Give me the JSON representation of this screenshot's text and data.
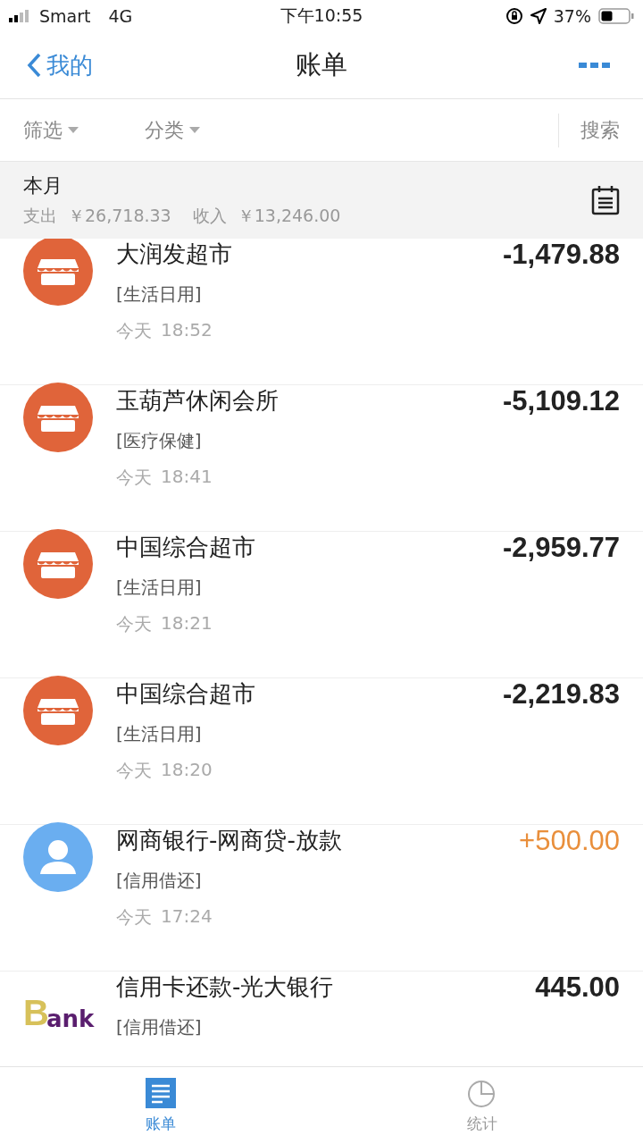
{
  "status_bar": {
    "carrier": "Smart",
    "network": "4G",
    "time": "下午10:55",
    "battery": "37%"
  },
  "nav": {
    "back": "我的",
    "title": "账单"
  },
  "filters": [
    {
      "label": "筛选"
    },
    {
      "label": "分类"
    }
  ],
  "search": "搜索",
  "summary": {
    "period": "本月",
    "expense_label": "支出",
    "expense": "￥26,718.33",
    "income_label": "收入",
    "income": "￥13,246.00"
  },
  "transactions": [
    {
      "kind": "store",
      "name": "大润发超市",
      "category": "[生活日用]",
      "day": "今天",
      "time": "18:52",
      "amount": "-1,479.88",
      "income": false
    },
    {
      "kind": "store",
      "name": "玉葫芦休闲会所",
      "category": "[医疗保健]",
      "day": "今天",
      "time": "18:41",
      "amount": "-5,109.12",
      "income": false
    },
    {
      "kind": "store",
      "name": "中国综合超市",
      "category": "[生活日用]",
      "day": "今天",
      "time": "18:21",
      "amount": "-2,959.77",
      "income": false
    },
    {
      "kind": "store",
      "name": "中国综合超市",
      "category": "[生活日用]",
      "day": "今天",
      "time": "18:20",
      "amount": "-2,219.83",
      "income": false
    },
    {
      "kind": "person",
      "name": "网商银行-网商贷-放款",
      "category": "[信用借还]",
      "day": "今天",
      "time": "17:24",
      "amount": "+500.00",
      "income": true
    },
    {
      "kind": "bank",
      "logo": {
        "initial": "B",
        "rest": "ank"
      },
      "name": "信用卡还款-光大银行",
      "category": "[信用借还]",
      "amount": "445.00",
      "income": false
    }
  ],
  "tab_bar": [
    {
      "label": "账单",
      "kind": "list",
      "selected": true
    },
    {
      "label": "统计",
      "kind": "pie",
      "selected": false
    }
  ]
}
